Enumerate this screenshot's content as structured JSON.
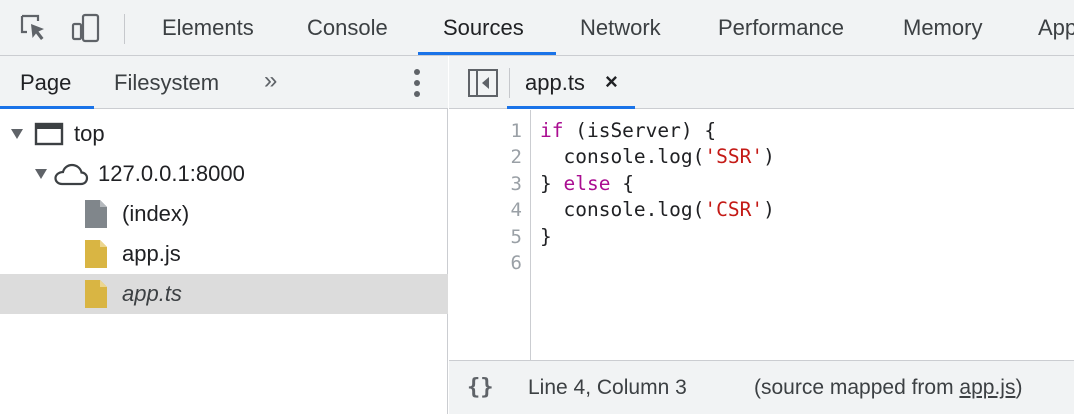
{
  "toolbar": {
    "inspect_icon": "inspect-element-icon",
    "device_icon": "device-toolbar-icon",
    "tabs": [
      {
        "label": "Elements"
      },
      {
        "label": "Console"
      },
      {
        "label": "Sources",
        "active": true
      },
      {
        "label": "Network"
      },
      {
        "label": "Performance"
      },
      {
        "label": "Memory"
      },
      {
        "label": "Application"
      }
    ]
  },
  "navigator": {
    "tabs": [
      {
        "label": "Page",
        "active": true
      },
      {
        "label": "Filesystem"
      }
    ],
    "more_label": "»",
    "menu_icon": "more-vertical-icon",
    "tree": [
      {
        "label": "top",
        "icon": "frame-icon",
        "expanded": true
      },
      {
        "label": "127.0.0.1:8000",
        "icon": "cloud-icon",
        "expanded": true
      },
      {
        "label": "(index)",
        "icon": "document-icon"
      },
      {
        "label": "app.js",
        "icon": "script-file-icon"
      },
      {
        "label": "app.ts",
        "icon": "script-file-icon",
        "selected": true
      }
    ]
  },
  "editor": {
    "toggle_icon": "toggle-navigator-icon",
    "open_tab": {
      "label": "app.ts",
      "close": "×"
    },
    "line_numbers": [
      "1",
      "2",
      "3",
      "4",
      "5",
      "6"
    ],
    "code": {
      "l1_kw": "if",
      "l1_rest": " (isServer) {",
      "l2_pre": "  console.log(",
      "l2_str": "'SSR'",
      "l2_post": ")",
      "l3_pre": "} ",
      "l3_kw": "else",
      "l3_post": " {",
      "l4_pre": "  console.log(",
      "l4_str": "'CSR'",
      "l4_post": ")",
      "l5": "}"
    },
    "status": {
      "pretty_print": "{}",
      "position": "Line 4, Column 3",
      "mapped_prefix": "(source mapped from ",
      "mapped_link": "app.js",
      "mapped_suffix": ")"
    }
  },
  "colors": {
    "accent": "#1a73e8",
    "keyword": "#aa0d91",
    "string": "#c41a16",
    "file_yellow": "#d9b543",
    "file_gray": "#80868b"
  }
}
